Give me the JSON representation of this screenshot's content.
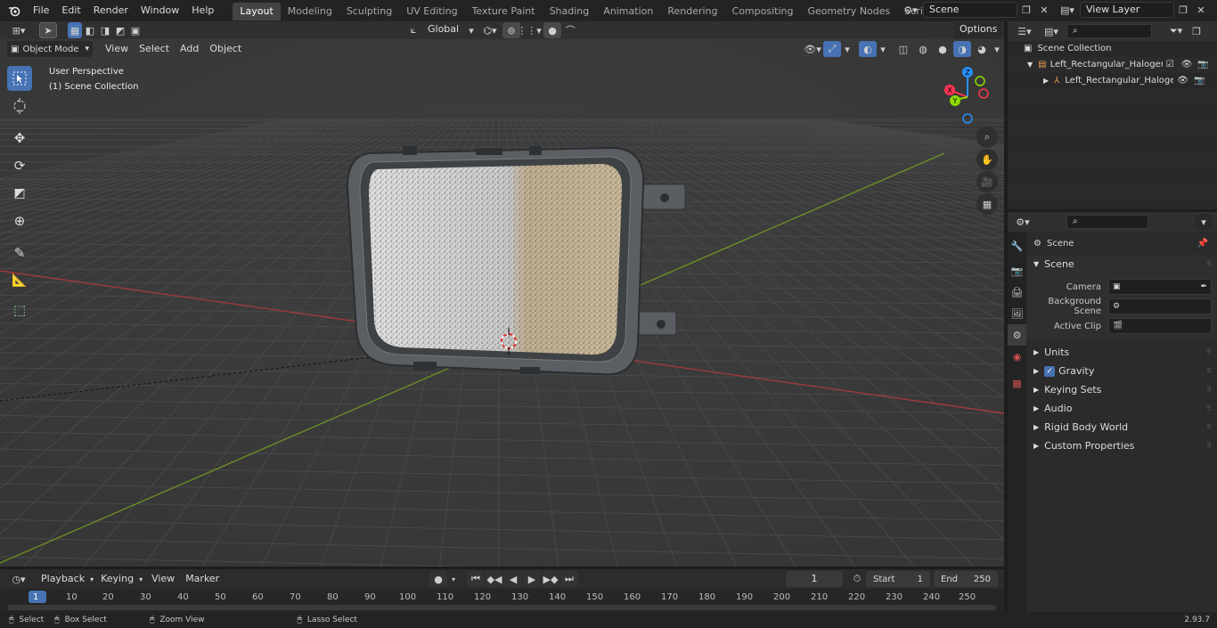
{
  "topbar": {
    "menus": [
      "File",
      "Edit",
      "Render",
      "Window",
      "Help"
    ],
    "workspaces": [
      "Layout",
      "Modeling",
      "Sculpting",
      "UV Editing",
      "Texture Paint",
      "Shading",
      "Animation",
      "Rendering",
      "Compositing",
      "Geometry Nodes",
      "Scripting"
    ],
    "active_workspace": "Layout",
    "scene_name": "Scene",
    "view_layer_name": "View Layer"
  },
  "viewport_header": {
    "transform_orientation": "Global",
    "options_label": "Options",
    "mode": "Object Mode",
    "menus": [
      "View",
      "Select",
      "Add",
      "Object"
    ]
  },
  "viewport": {
    "perspective_label": "User Perspective",
    "collection_label": "(1) Scene Collection",
    "gizmo_axes": {
      "x": "X",
      "y": "Y",
      "z": "Z"
    }
  },
  "outliner": {
    "root": "Scene Collection",
    "items": [
      {
        "label": "Left_Rectangular_Halogen_H",
        "indent": 1
      },
      {
        "label": "Left_Rectangular_Haloge",
        "indent": 2
      }
    ]
  },
  "properties": {
    "context_title": "Scene",
    "section_title": "Scene",
    "fields": [
      {
        "label": "Camera"
      },
      {
        "label": "Background Scene"
      },
      {
        "label": "Active Clip"
      }
    ],
    "panels": [
      "Units",
      "Gravity",
      "Keying Sets",
      "Audio",
      "Rigid Body World",
      "Custom Properties"
    ],
    "gravity_checked": true
  },
  "timeline": {
    "menus": [
      "Playback",
      "Keying",
      "View",
      "Marker"
    ],
    "current_frame": "1",
    "start_label": "Start",
    "start_value": "1",
    "end_label": "End",
    "end_value": "250",
    "ticks": [
      "1",
      "10",
      "20",
      "30",
      "40",
      "50",
      "60",
      "70",
      "80",
      "90",
      "100",
      "110",
      "120",
      "130",
      "140",
      "150",
      "160",
      "170",
      "180",
      "190",
      "200",
      "210",
      "220",
      "230",
      "240",
      "250"
    ]
  },
  "statusbar": {
    "items": [
      "Select",
      "Box Select",
      "Zoom View",
      "Lasso Select"
    ],
    "version": "2.93.7"
  },
  "colors": {
    "accent": "#4772b3",
    "axis_x": "#ff3352",
    "axis_y": "#8bdc00",
    "axis_z": "#2890ff"
  }
}
